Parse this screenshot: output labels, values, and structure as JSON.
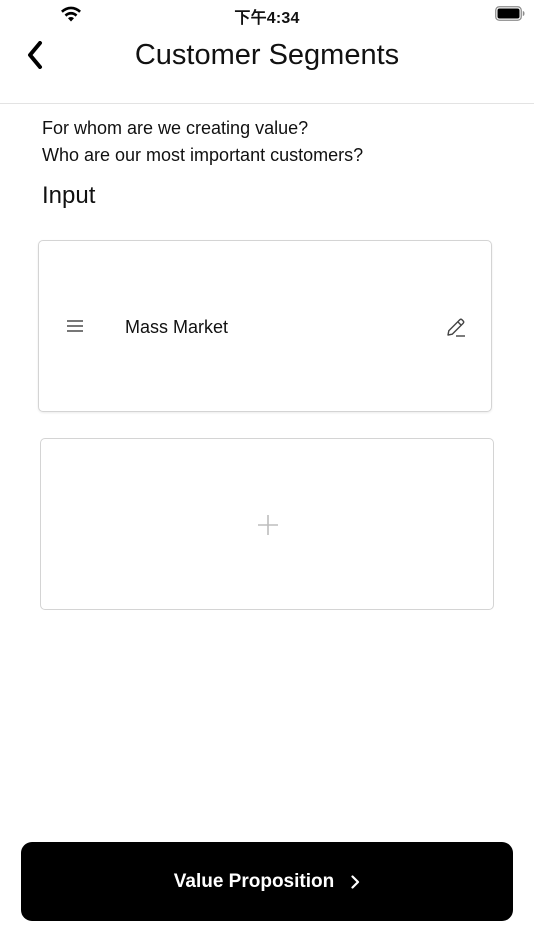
{
  "status_bar": {
    "time": "下午4:34",
    "wifi_icon": "wifi-icon",
    "battery_icon": "battery-icon"
  },
  "nav": {
    "back_icon": "chevron-left-icon",
    "title": "Customer Segments"
  },
  "content": {
    "question_1": "For whom are we creating value?",
    "question_2": "Who are our most important customers?",
    "section_label": "Input",
    "segments": [
      {
        "label": "Mass Market",
        "drag_icon": "drag-handle-icon",
        "edit_icon": "pencil-icon"
      }
    ],
    "add_icon": "plus-icon"
  },
  "footer": {
    "next_label": "Value Proposition",
    "next_icon": "chevron-right-icon",
    "button_color": "#000000"
  }
}
